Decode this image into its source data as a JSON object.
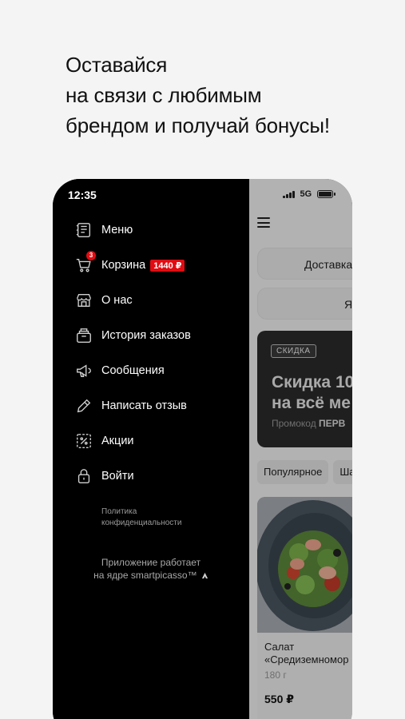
{
  "headline": {
    "line1": "Оставайся",
    "line2": "на связи с любимым",
    "line3": "брендом и получай бонусы!"
  },
  "status": {
    "time": "12:35",
    "network": "5G"
  },
  "drawer": {
    "items": [
      {
        "label": "Меню",
        "icon": "menu-book-icon"
      },
      {
        "label": "Корзина",
        "icon": "cart-icon",
        "badge": "3",
        "amount": "1440 ₽"
      },
      {
        "label": "О нас",
        "icon": "store-icon"
      },
      {
        "label": "История заказов",
        "icon": "order-history-icon"
      },
      {
        "label": "Сообщения",
        "icon": "megaphone-icon"
      },
      {
        "label": "Написать отзыв",
        "icon": "pencil-icon"
      },
      {
        "label": "Акции",
        "icon": "discount-icon"
      },
      {
        "label": "Войти",
        "icon": "lock-icon"
      }
    ],
    "policy_line1": "Политика",
    "policy_line2": "конфиденциальности",
    "powered_line1": "Приложение работает",
    "powered_line2": "на ядре smartpicasso™"
  },
  "app": {
    "delivery_tab": "Доставка",
    "second_tab": "Ядр",
    "promo": {
      "badge": "СКИДКА",
      "title_line1": "Скидка 10",
      "title_line2": "на всё ме",
      "code_label": "Промокод",
      "code_value": "ПЕРВ"
    },
    "categories": [
      "Популярное",
      "Ша"
    ],
    "product": {
      "name_line1": "Салат",
      "name_line2": "«Средиземномор",
      "weight": "180 г",
      "price": "550 ₽"
    }
  },
  "colors": {
    "accent": "#e10c12",
    "drawer_bg": "#000000",
    "page_bg": "#f4f4f4"
  }
}
